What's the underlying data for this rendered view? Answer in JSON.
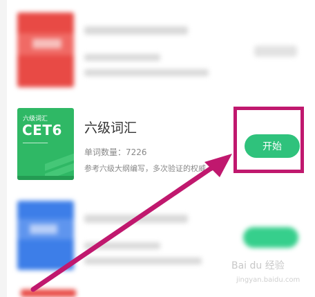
{
  "featured_book": {
    "cover_small_title": "六级词汇",
    "cover_big_title": "CET6",
    "title": "六级词汇",
    "word_count": "单词数量：7226",
    "description": "参考六级大纲编写，多次验证的权威...",
    "start_label": "开始"
  },
  "watermark": {
    "text": "Bai du 经验",
    "url": "jingyan.baidu.com"
  },
  "colors": {
    "accent_green": "#2fc27c",
    "highlight_magenta": "#c0186e",
    "cover_red": "#e84a45",
    "cover_green": "#2fb865",
    "cover_blue": "#3d7ee8"
  }
}
